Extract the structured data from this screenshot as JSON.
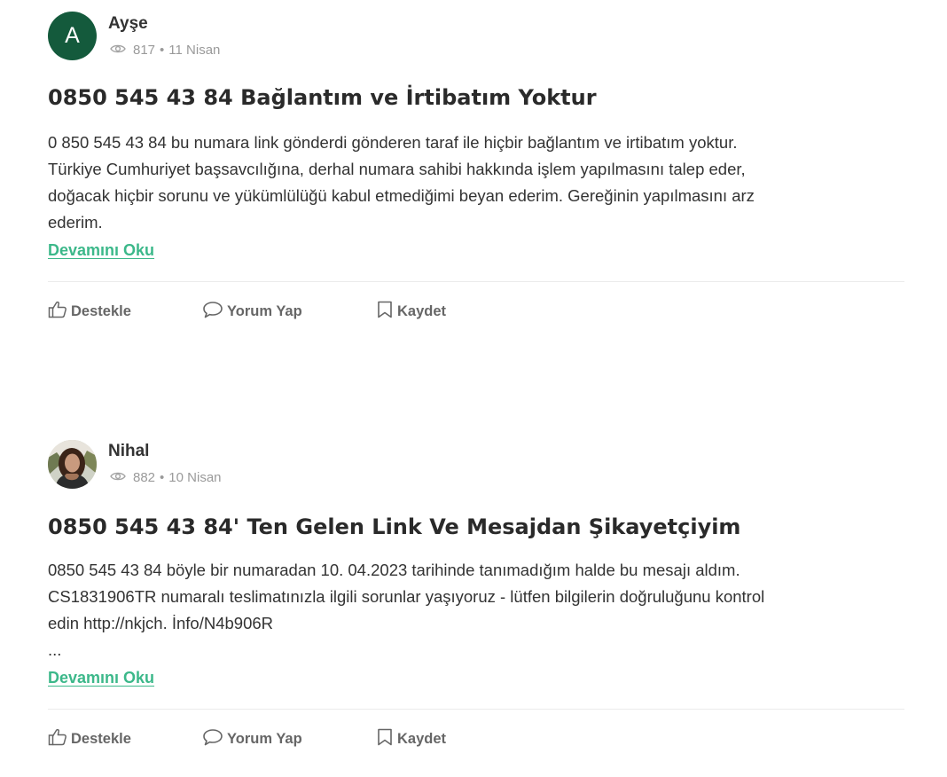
{
  "posts": [
    {
      "author": "Ayşe",
      "avatar_letter": "A",
      "views": "817",
      "separator": "•",
      "date": "11 Nisan",
      "title": "0850 545 43 84 Bağlantım ve İrtibatım Yoktur",
      "body_lines": [
        "0 850 545 43 84 bu numara link gönderdi gönderen taraf ile hiçbir bağlantım ve irtibatım yoktur.",
        "Türkiye Cumhuriyet başsavcılığına, derhal numara sahibi hakkında işlem yapılmasını talep eder,",
        "doğacak hiçbir sorunu ve yükümlülüğü kabul etmediğimi beyan ederim. Gereğinin yapılmasını arz",
        "ederim."
      ],
      "read_more": "Devamını Oku",
      "actions": {
        "support": "Destekle",
        "comment": "Yorum Yap",
        "save": "Kaydet"
      }
    },
    {
      "author": "Nihal",
      "views": "882",
      "separator": "•",
      "date": "10 Nisan",
      "title": "0850 545 43 84' Ten Gelen Link Ve Mesajdan Şikayetçiyim",
      "body_lines": [
        "0850 545 43 84 böyle bir numaradan 10. 04.2023 tarihinde tanımadığım halde bu mesajı aldım.",
        "CS1831906TR numaralı teslimatınızla ilgili sorunlar yaşıyoruz - lütfen bilgilerin doğruluğunu kontrol",
        "edin http://nkjch. İnfo/N4b906R",
        "..."
      ],
      "read_more": "Devamını Oku",
      "actions": {
        "support": "Destekle",
        "comment": "Yorum Yap",
        "save": "Kaydet"
      }
    }
  ],
  "colors": {
    "avatar_bg": "#145a3c",
    "link": "#3cb88a",
    "meta": "#9a9a9a",
    "action": "#666666"
  },
  "icons": [
    "eye-icon",
    "thumbs-up-icon",
    "comment-icon",
    "bookmark-icon"
  ]
}
